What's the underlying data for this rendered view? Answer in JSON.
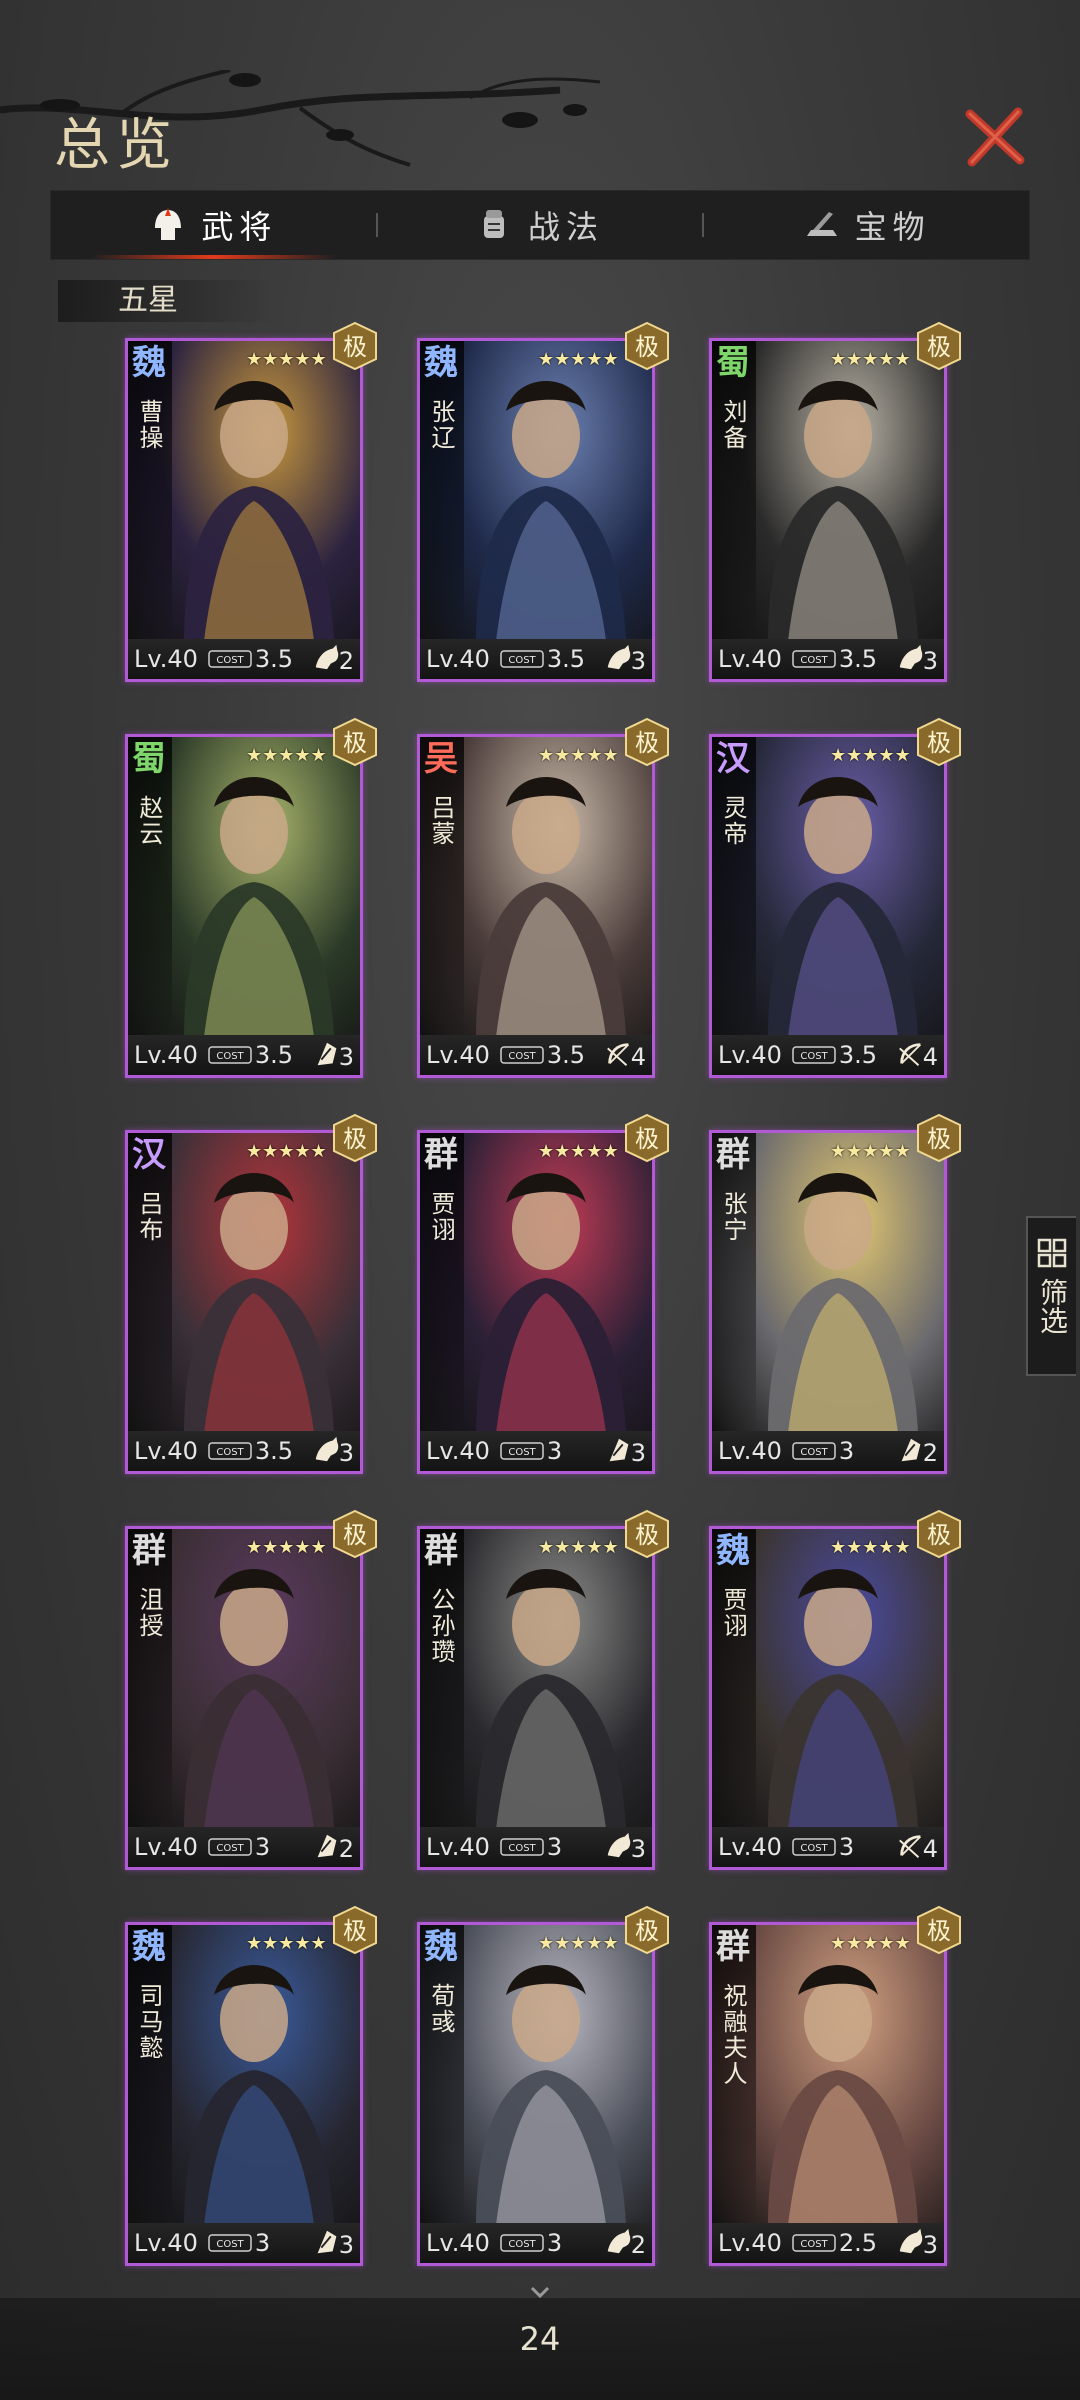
{
  "header": {
    "title": "总览"
  },
  "tabs": [
    {
      "label": "武将",
      "icon": "helmet-icon",
      "active": true
    },
    {
      "label": "战法",
      "icon": "fist-scroll-icon",
      "active": false
    },
    {
      "label": "宝物",
      "icon": "treasure-icon",
      "active": false
    }
  ],
  "section": {
    "label": "五星"
  },
  "generals": [
    {
      "faction": "魏",
      "faction_color": "#8fb6ff",
      "name": "曹操",
      "stars": "★★★★★",
      "level": "Lv.40",
      "cost": "3.5",
      "troop_icon": "cavalry-icon",
      "troop_count": "2",
      "palette": [
        "#2c2340",
        "#c7973d"
      ]
    },
    {
      "faction": "魏",
      "faction_color": "#8fb6ff",
      "name": "张辽",
      "stars": "★★★★★",
      "level": "Lv.40",
      "cost": "3.5",
      "troop_icon": "cavalry-icon",
      "troop_count": "3",
      "palette": [
        "#1f2a4a",
        "#6b7fb0"
      ]
    },
    {
      "faction": "蜀",
      "faction_color": "#7fd66a",
      "name": "刘备",
      "stars": "★★★★★",
      "level": "Lv.40",
      "cost": "3.5",
      "troop_icon": "cavalry-icon",
      "troop_count": "3",
      "palette": [
        "#2a2a2a",
        "#b9b3a6"
      ]
    },
    {
      "faction": "蜀",
      "faction_color": "#7fd66a",
      "name": "赵云",
      "stars": "★★★★★",
      "level": "Lv.40",
      "cost": "3.5",
      "troop_icon": "shield-icon",
      "troop_count": "3",
      "palette": [
        "#2b3a28",
        "#a7b36a"
      ]
    },
    {
      "faction": "吴",
      "faction_color": "#ff6b5a",
      "name": "吕蒙",
      "stars": "★★★★★",
      "level": "Lv.40",
      "cost": "3.5",
      "troop_icon": "bow-icon",
      "troop_count": "4",
      "palette": [
        "#4a3c3a",
        "#c9b9a8"
      ]
    },
    {
      "faction": "汉",
      "faction_color": "#c89cff",
      "name": "灵帝",
      "stars": "★★★★★",
      "level": "Lv.40",
      "cost": "3.5",
      "troop_icon": "bow-icon",
      "troop_count": "4",
      "palette": [
        "#252838",
        "#6a5ea8"
      ]
    },
    {
      "faction": "汉",
      "faction_color": "#c89cff",
      "name": "吕布",
      "stars": "★★★★★",
      "level": "Lv.40",
      "cost": "3.5",
      "troop_icon": "cavalry-icon",
      "troop_count": "3",
      "palette": [
        "#3a3038",
        "#b3343a"
      ]
    },
    {
      "faction": "群",
      "faction_color": "#dddddd",
      "name": "贾诩",
      "stars": "★★★★★",
      "level": "Lv.40",
      "cost": "3",
      "troop_icon": "shield-icon",
      "troop_count": "3",
      "palette": [
        "#2b2036",
        "#c23b55"
      ]
    },
    {
      "faction": "群",
      "faction_color": "#dddddd",
      "name": "张宁",
      "stars": "★★★★★",
      "level": "Lv.40",
      "cost": "3",
      "troop_icon": "shield-icon",
      "troop_count": "2",
      "palette": [
        "#6b6a6e",
        "#e0c670"
      ]
    },
    {
      "faction": "群",
      "faction_color": "#dddddd",
      "name": "沮授",
      "stars": "★★★★★",
      "level": "Lv.40",
      "cost": "3",
      "troop_icon": "shield-icon",
      "troop_count": "2",
      "palette": [
        "#3a2e34",
        "#5a3a5e"
      ]
    },
    {
      "faction": "群",
      "faction_color": "#dddddd",
      "name": "公孙瓒",
      "stars": "★★★★★",
      "level": "Lv.40",
      "cost": "3",
      "troop_icon": "cavalry-icon",
      "troop_count": "3",
      "palette": [
        "#2a2a2e",
        "#8a8a88"
      ]
    },
    {
      "faction": "魏",
      "faction_color": "#8fb6ff",
      "name": "贾诩",
      "stars": "★★★★★",
      "level": "Lv.40",
      "cost": "3",
      "troop_icon": "bow-icon",
      "troop_count": "4",
      "palette": [
        "#3a3430",
        "#4a4aa0"
      ]
    },
    {
      "faction": "魏",
      "faction_color": "#8fb6ff",
      "name": "司马懿",
      "stars": "★★★★★",
      "level": "Lv.40",
      "cost": "3",
      "troop_icon": "shield-icon",
      "troop_count": "3",
      "palette": [
        "#262630",
        "#3a5a9a"
      ]
    },
    {
      "faction": "魏",
      "faction_color": "#8fb6ff",
      "name": "荀彧",
      "stars": "★★★★★",
      "level": "Lv.40",
      "cost": "3",
      "troop_icon": "cavalry-icon",
      "troop_count": "2",
      "palette": [
        "#4a4e58",
        "#b8b6c0"
      ]
    },
    {
      "faction": "群",
      "faction_color": "#dddddd",
      "name": "祝融夫人",
      "stars": "★★★★★",
      "level": "Lv.40",
      "cost": "2.5",
      "troop_icon": "cavalry-icon",
      "troop_count": "3",
      "palette": [
        "#6a4a44",
        "#d0a080"
      ]
    }
  ],
  "badge_text": "极",
  "cost_label": "COST",
  "filter": {
    "label": "筛选",
    "icon": "grid-icon"
  },
  "pagination": {
    "page": "24"
  },
  "colors": {
    "card_border": "#b25ad6",
    "accent": "#e23b1c",
    "close": "#c0392b"
  }
}
